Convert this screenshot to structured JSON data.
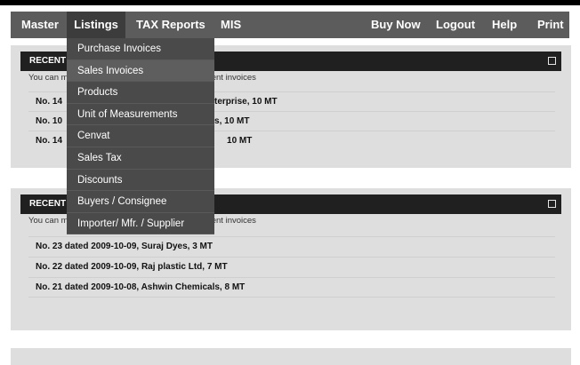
{
  "nav": {
    "items": [
      {
        "label": "Master"
      },
      {
        "label": "Listings"
      },
      {
        "label": "TAX Reports"
      },
      {
        "label": "MIS"
      },
      {
        "label": "Buy Now"
      },
      {
        "label": "Logout"
      },
      {
        "label": "Help"
      },
      {
        "label": "Print"
      }
    ],
    "active_item": "Listings"
  },
  "dropdown": {
    "items": [
      {
        "label": "Purchase Invoices"
      },
      {
        "label": "Sales Invoices"
      },
      {
        "label": "Products"
      },
      {
        "label": "Unit of Measurements"
      },
      {
        "label": "Cenvat"
      },
      {
        "label": "Sales Tax"
      },
      {
        "label": "Discounts"
      },
      {
        "label": "Buyers / Consignee"
      },
      {
        "label": "Importer/ Mfr. / Supplier"
      }
    ],
    "highlighted_item": "Sales Invoices"
  },
  "panel1": {
    "title": "RECENT I",
    "note_left": "You can m",
    "note_right": "recent invoices",
    "rows": [
      {
        "left": "No. 14",
        "right": "terprise, 10 MT"
      },
      {
        "left": "No. 10",
        "right": "s, 10 MT"
      },
      {
        "left": "No. 14",
        "right": "10 MT"
      }
    ]
  },
  "panel2": {
    "title": "RECENT S",
    "note_left": "You can m",
    "note_right": "recent invoices",
    "rows": [
      {
        "text": "No. 23 dated 2009-10-09, Suraj Dyes, 3 MT"
      },
      {
        "text": "No. 22 dated 2009-10-09, Raj plastic Ltd, 7 MT"
      },
      {
        "text": "No. 21 dated 2009-10-08, Ashwin Chemicals, 8 MT"
      }
    ]
  }
}
